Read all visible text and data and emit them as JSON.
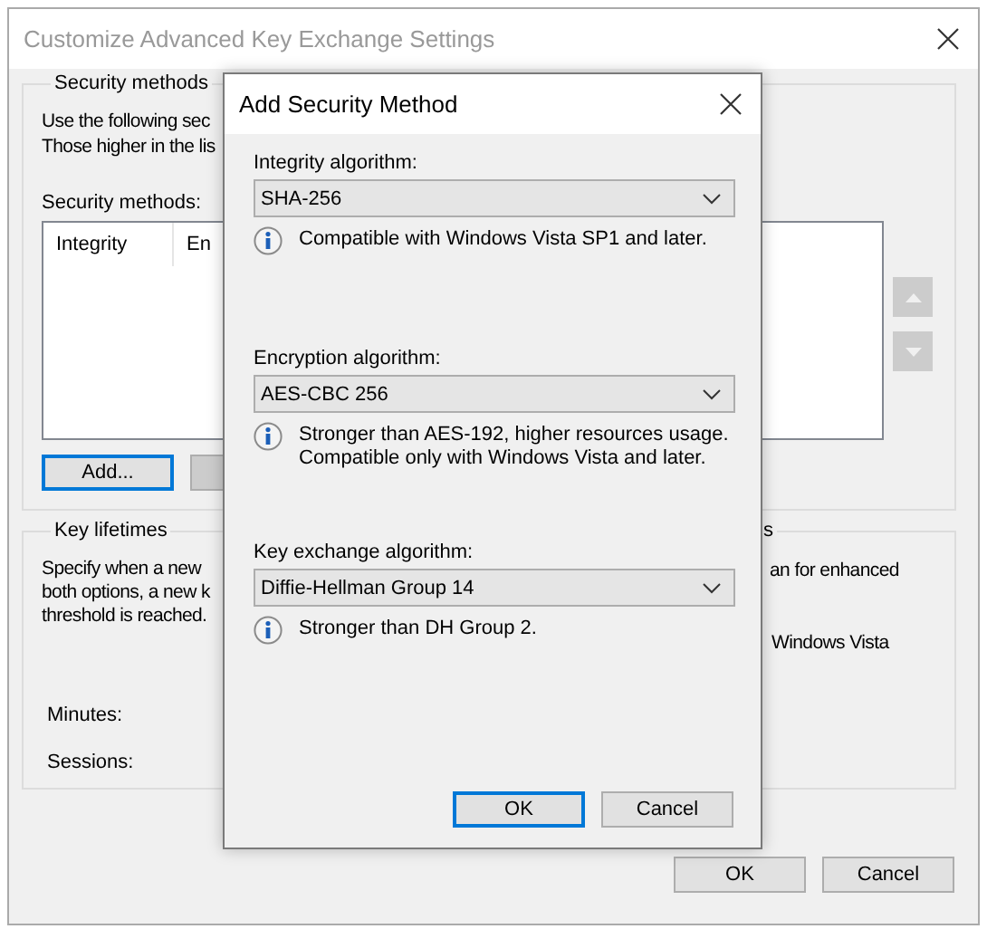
{
  "window": {
    "title": "Customize Advanced Key Exchange Settings"
  },
  "security_methods_group": {
    "title": "Security methods",
    "description": [
      "Use the following sec",
      "Those higher in the lis"
    ],
    "list_label": "Security methods:",
    "columns": [
      "Integrity",
      "En"
    ],
    "add_button": {
      "label": "Add...",
      "default": true
    }
  },
  "key_lifetimes_group": {
    "title": "Key lifetimes",
    "description": [
      "Specify when a new",
      "both options, a new k",
      "threshold is reached."
    ],
    "fields": [
      "Minutes:",
      "Sessions:"
    ]
  },
  "options_group": {
    "title": "s",
    "lines": [
      "an for enhanced",
      "Windows Vista"
    ]
  },
  "buttons": [
    {
      "label": "OK",
      "default": false
    },
    {
      "label": "Cancel",
      "default": false
    }
  ],
  "dialog": {
    "title": "Add Security Method",
    "sections": [
      {
        "label": "Integrity algorithm:",
        "value": "SHA-256",
        "info": [
          "Compatible with Windows Vista SP1 and later."
        ]
      },
      {
        "label": "Encryption algorithm:",
        "value": "AES-CBC 256",
        "info": [
          "Stronger than AES-192, higher resources usage.",
          "Compatible only with Windows Vista and later."
        ]
      },
      {
        "label": "Key exchange algorithm:",
        "value": "Diffie-Hellman Group 14",
        "info": [
          "Stronger than DH Group 2."
        ]
      }
    ],
    "buttons": [
      {
        "label": "OK",
        "default": true
      },
      {
        "label": "Cancel",
        "default": false
      }
    ]
  }
}
